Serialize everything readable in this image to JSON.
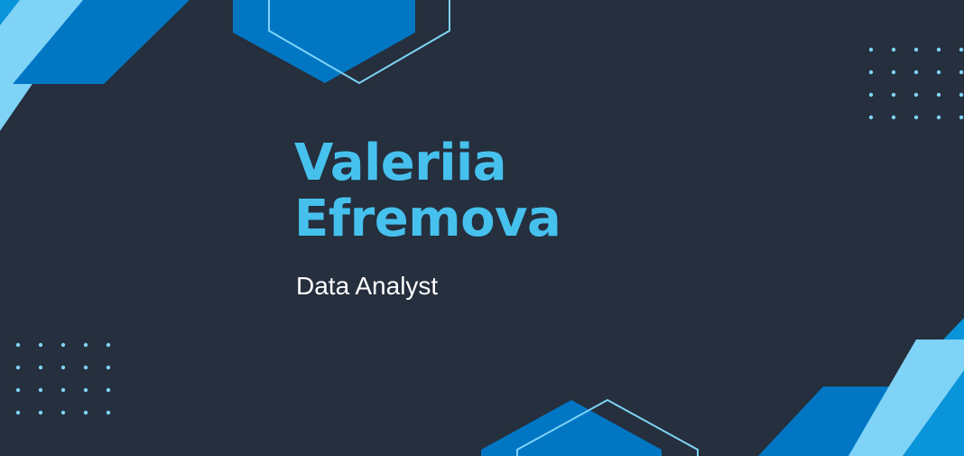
{
  "profile": {
    "first_name": "Valeriia",
    "last_name": "Efremova",
    "title": "Data Analyst"
  },
  "colors": {
    "background": "#252f3d",
    "name_accent": "#46c1ee",
    "shape_dark_blue": "#0177c4",
    "shape_light_blue": "#7fd3f7",
    "shape_mid_blue": "#0a94da",
    "dots": "#7fd3f7",
    "title_text": "#ffffff"
  }
}
